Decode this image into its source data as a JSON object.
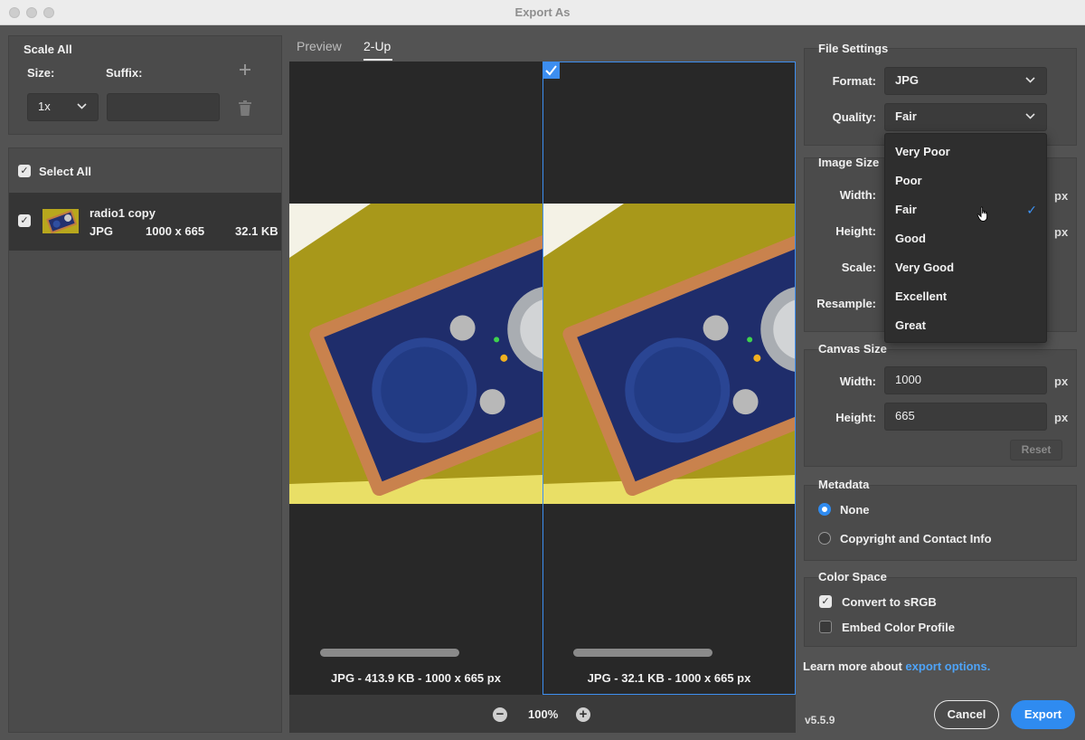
{
  "window": {
    "title": "Export As"
  },
  "scale_all": {
    "title": "Scale All",
    "size_label": "Size:",
    "suffix_label": "Suffix:",
    "size_value": "1x",
    "suffix_value": ""
  },
  "assets": {
    "select_all_label": "Select All",
    "items": [
      {
        "name": "radio1 copy",
        "format": "JPG",
        "dimensions": "1000 x 665",
        "file_size": "32.1 KB"
      }
    ]
  },
  "preview": {
    "tabs": [
      {
        "label": "Preview"
      },
      {
        "label": "2-Up"
      }
    ],
    "active_tab": "2-Up",
    "left_caption": "JPG - 413.9 KB - 1000 x 665 px",
    "right_caption": "JPG - 32.1 KB - 1000 x 665 px",
    "zoom": "100%"
  },
  "file_settings": {
    "title": "File Settings",
    "format_label": "Format:",
    "format_value": "JPG",
    "quality_label": "Quality:",
    "quality_value": "Fair",
    "quality_options": [
      {
        "label": "Very Poor"
      },
      {
        "label": "Poor"
      },
      {
        "label": "Fair",
        "selected": true
      },
      {
        "label": "Good"
      },
      {
        "label": "Very Good"
      },
      {
        "label": "Excellent"
      },
      {
        "label": "Great"
      }
    ]
  },
  "image_size": {
    "title": "Image Size",
    "width_label": "Width:",
    "height_label": "Height:",
    "scale_label": "Scale:",
    "resample_label": "Resample:",
    "unit": "px"
  },
  "canvas_size": {
    "title": "Canvas Size",
    "width_label": "Width:",
    "width_value": "1000",
    "height_label": "Height:",
    "height_value": "665",
    "unit": "px",
    "reset_label": "Reset"
  },
  "metadata": {
    "title": "Metadata",
    "options": [
      {
        "label": "None",
        "selected": true
      },
      {
        "label": "Copyright and Contact Info",
        "selected": false
      }
    ]
  },
  "color_space": {
    "title": "Color Space",
    "convert_label": "Convert to sRGB",
    "convert_checked": true,
    "embed_label": "Embed Color Profile",
    "embed_checked": false
  },
  "footer": {
    "learn_more_text": "Learn more about",
    "learn_more_link": "export options.",
    "version": "v5.5.9",
    "cancel_label": "Cancel",
    "export_label": "Export"
  },
  "colors": {
    "accent": "#2f8bf0",
    "link": "#4ea3f7"
  }
}
